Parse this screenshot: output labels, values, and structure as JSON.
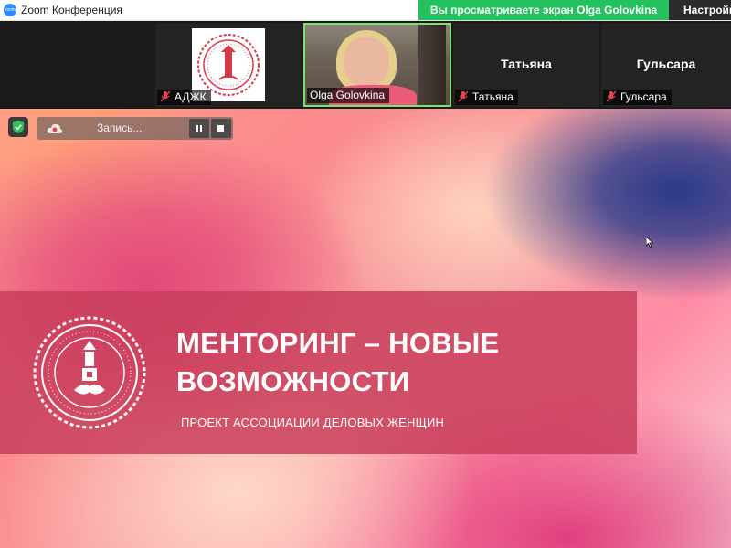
{
  "window": {
    "title": "Zoom Конференция",
    "app_icon_text": "zoom"
  },
  "header": {
    "share_banner": "Вы просматриваете экран Olga Golovkina",
    "settings_label": "Настройки"
  },
  "participants": [
    {
      "name": "АДЖК",
      "big_label": "",
      "muted": true
    },
    {
      "name": "Olga Golovkina",
      "big_label": "",
      "muted": false
    },
    {
      "name": "Татьяна",
      "big_label": "Татьяна",
      "muted": true
    },
    {
      "name": "Гульсара",
      "big_label": "Гульсара",
      "muted": true
    }
  ],
  "recording": {
    "label": "Запись..."
  },
  "slide": {
    "title_line1": "МЕНТОРИНГ – НОВЫЕ",
    "title_line2": "ВОЗМОЖНОСТИ",
    "subtitle": "ПРОЕКТ АССОЦИАЦИИ ДЕЛОВЫХ ЖЕНЩИН"
  },
  "colors": {
    "share_banner": "#23c25f",
    "active_speaker_border": "#7ee36a",
    "banner_overlay": "#c83e5a",
    "mute_icon": "#e8434f",
    "seal": "#d83a4a"
  }
}
